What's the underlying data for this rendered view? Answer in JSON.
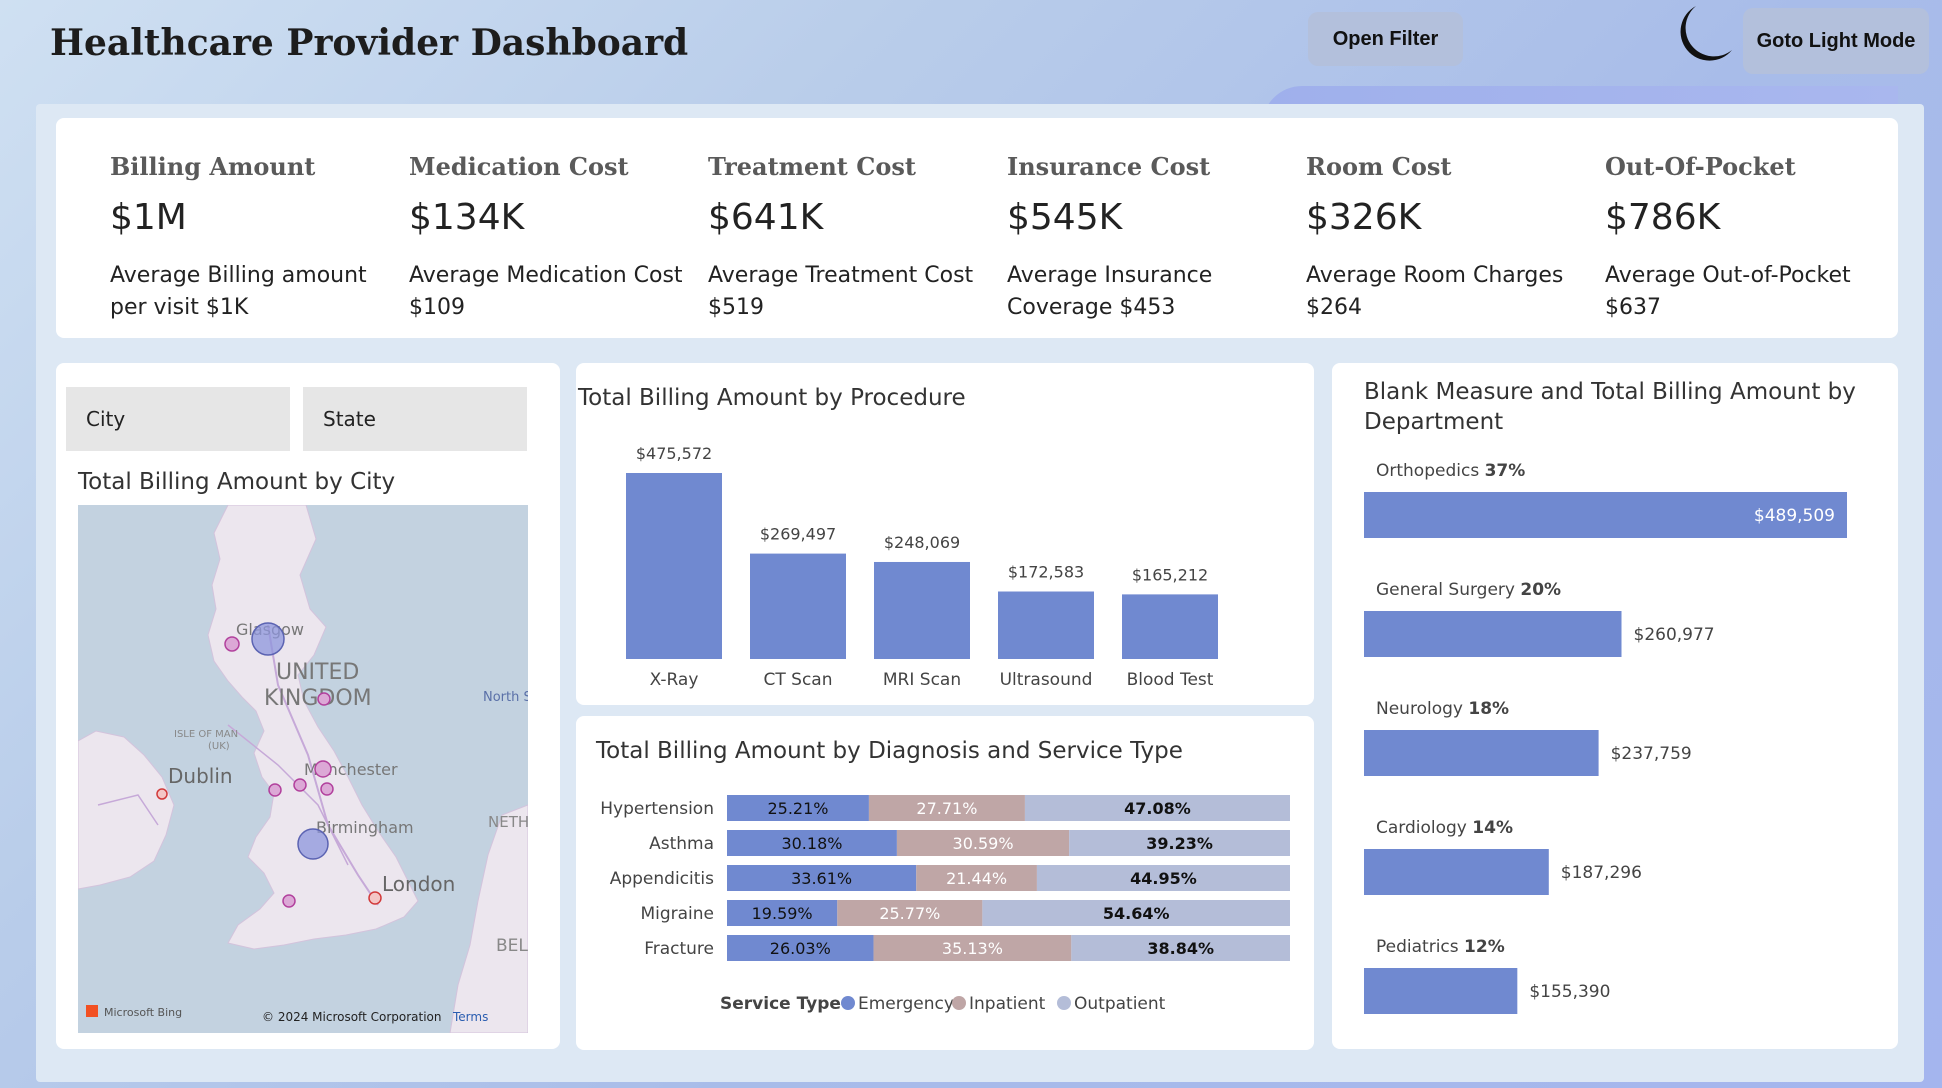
{
  "header": {
    "title": "Healthcare Provider Dashboard",
    "open_filter": "Open Filter",
    "light_mode": "Goto Light Mode"
  },
  "kpis": [
    {
      "title": "Billing Amount",
      "value": "$1M",
      "sub": "Average Billing amount per visit $1K"
    },
    {
      "title": "Medication Cost",
      "value": "$134K",
      "sub": "Average Medication Cost $109"
    },
    {
      "title": "Treatment Cost",
      "value": "$641K",
      "sub": "Average Treatment Cost $519"
    },
    {
      "title": "Insurance Cost",
      "value": "$545K",
      "sub": "Average Insurance Coverage $453"
    },
    {
      "title": "Room Cost",
      "value": "$326K",
      "sub": "Average Room Charges $264"
    },
    {
      "title": "Out-Of-Pocket",
      "value": "$786K",
      "sub": "Average Out-of-Pocket $637"
    }
  ],
  "slicers": {
    "city": "City",
    "state": "State"
  },
  "map": {
    "title": "Total Billing Amount by City",
    "labels": {
      "glasgow": "Glasgow",
      "united": "UNITED",
      "kingdom": "KINGDOM",
      "north_sea": "North S",
      "isle_of_man": "ISLE OF MAN",
      "uk": "(UK)",
      "dublin": "Dublin",
      "manchester": "Manchester",
      "neth": "NETH",
      "birmingham": "Birmingham",
      "london": "London",
      "bel": "BEL"
    },
    "attribution": {
      "bing": "Microsoft Bing",
      "copyright": "© 2024 Microsoft Corporation",
      "terms": "Terms"
    }
  },
  "chart_data": [
    {
      "type": "bar",
      "title": "Total Billing Amount by Procedure",
      "categories": [
        "X-Ray",
        "CT Scan",
        "MRI Scan",
        "Ultrasound",
        "Blood Test"
      ],
      "values": [
        475572,
        269497,
        248069,
        172583,
        165212
      ],
      "data_labels": [
        "$475,572",
        "$269,497",
        "$248,069",
        "$172,583",
        "$165,212"
      ],
      "color": "#7089d0",
      "ylim": [
        0,
        475572
      ]
    },
    {
      "type": "bar",
      "orientation": "horizontal",
      "stacked": "100%",
      "title": "Total Billing Amount by Diagnosis and Service Type",
      "categories": [
        "Hypertension",
        "Asthma",
        "Appendicitis",
        "Migraine",
        "Fracture"
      ],
      "legend_title": "Service Type",
      "legend_position": "bottom",
      "series": [
        {
          "name": "Emergency",
          "color": "#7089d0",
          "values": [
            25.21,
            30.18,
            33.61,
            19.59,
            26.03
          ],
          "labels": [
            "25.21%",
            "30.18%",
            "33.61%",
            "19.59%",
            "26.03%"
          ]
        },
        {
          "name": "Inpatient",
          "color": "#bfa6a6",
          "values": [
            27.71,
            30.59,
            21.44,
            25.77,
            35.13
          ],
          "labels": [
            "27.71%",
            "30.59%",
            "21.44%",
            "25.77%",
            "35.13%"
          ]
        },
        {
          "name": "Outpatient",
          "color": "#b4bdd8",
          "values": [
            47.08,
            39.23,
            44.95,
            54.64,
            38.84
          ],
          "labels": [
            "47.08%",
            "39.23%",
            "44.95%",
            "54.64%",
            "38.84%"
          ]
        }
      ]
    },
    {
      "type": "bar",
      "orientation": "horizontal",
      "title": "Blank Measure and Total Billing Amount by Department",
      "categories": [
        "Orthopedics",
        "General Surgery",
        "Neurology",
        "Cardiology",
        "Pediatrics"
      ],
      "percents": [
        "37%",
        "20%",
        "18%",
        "14%",
        "12%"
      ],
      "values": [
        489509,
        260977,
        237759,
        187296,
        155390
      ],
      "data_labels": [
        "$489,509",
        "$260,977",
        "$237,759",
        "$187,296",
        "$155,390"
      ],
      "color": "#7089d0",
      "xlim": [
        0,
        489509
      ]
    }
  ]
}
